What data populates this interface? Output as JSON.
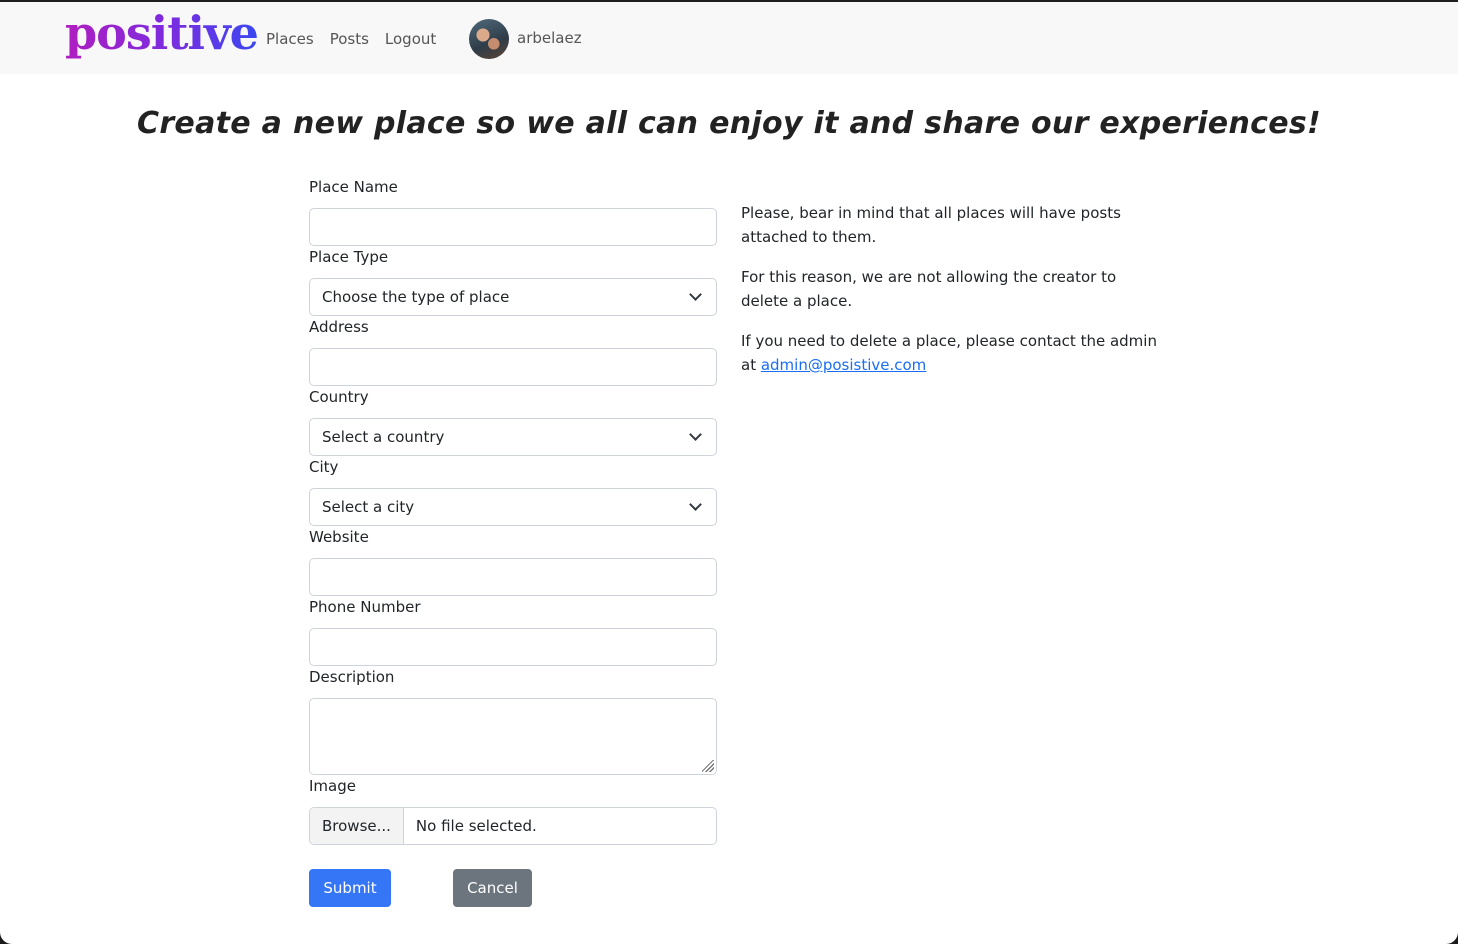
{
  "navbar": {
    "brand": "positive",
    "links": [
      "Places",
      "Posts",
      "Logout"
    ],
    "username": "arbelaez"
  },
  "page": {
    "title": "Create a new place so we all can enjoy it and share our experiences!"
  },
  "form": {
    "place_name": {
      "label": "Place Name",
      "value": ""
    },
    "place_type": {
      "label": "Place Type",
      "selected": "Choose the type of place"
    },
    "address": {
      "label": "Address",
      "value": ""
    },
    "country": {
      "label": "Country",
      "selected": "Select a country"
    },
    "city": {
      "label": "City",
      "selected": "Select a city"
    },
    "website": {
      "label": "Website",
      "value": ""
    },
    "phone": {
      "label": "Phone Number",
      "value": ""
    },
    "description": {
      "label": "Description",
      "value": ""
    },
    "image": {
      "label": "Image",
      "browse_label": "Browse...",
      "status": "No file selected."
    },
    "submit_label": "Submit",
    "cancel_label": "Cancel"
  },
  "info": {
    "paragraph1": "Please, bear in mind that all places will have posts attached to them.",
    "paragraph2": "For this reason, we are not allowing the creator to delete a place.",
    "paragraph3_prefix": "If you need to delete a place, please contact the admin at ",
    "contact_email": "admin@posistive.com"
  },
  "colors": {
    "primary": "#3476f6",
    "secondary": "#6c757d",
    "brand_gradient_start": "#b01ec0",
    "brand_gradient_end": "#3a48f0",
    "navbar_bg": "#f8f8f8"
  },
  "icons": [
    "avatar-image",
    "chevron-down-icon",
    "resize-handle-icon"
  ]
}
